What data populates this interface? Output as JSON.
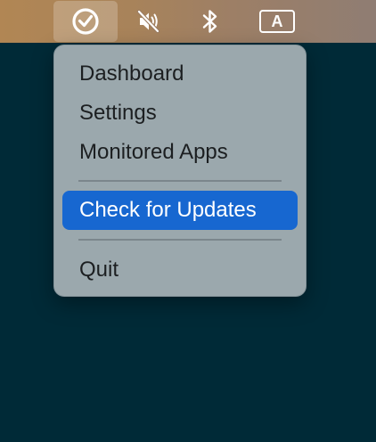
{
  "menubar": {
    "items": [
      {
        "icon": "checkmark-circle-icon",
        "active": true
      },
      {
        "icon": "speaker-muted-icon",
        "active": false
      },
      {
        "icon": "bluetooth-icon",
        "active": false
      },
      {
        "icon": "input-source-icon",
        "label": "A",
        "active": false
      }
    ]
  },
  "menu": {
    "items": [
      {
        "label": "Dashboard"
      },
      {
        "label": "Settings"
      },
      {
        "label": "Monitored Apps"
      },
      {
        "label": "Check for Updates",
        "highlighted": true
      },
      {
        "label": "Quit"
      }
    ]
  },
  "colors": {
    "desktop_background": "#002a37",
    "highlight": "#1767d0",
    "menu_background": "#a0acb2"
  }
}
